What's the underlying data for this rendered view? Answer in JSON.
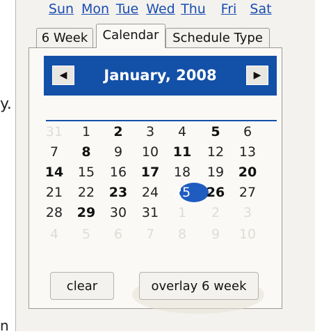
{
  "edge_text": {
    "left_char": "y.",
    "bottom_char": "n"
  },
  "tabs": [
    {
      "label": "6 Week",
      "active": false
    },
    {
      "label": "Calendar",
      "active": true
    },
    {
      "label": "Schedule Type",
      "active": false
    }
  ],
  "calendar": {
    "title": "January, 2008",
    "prev_icon": "left-triangle-icon",
    "next_icon": "right-triangle-icon",
    "header_color": "#1350a8",
    "weekdays": [
      "Sun",
      "Mon",
      "Tue",
      "Wed",
      "Thu",
      "Fri",
      "Sat"
    ],
    "weeks": [
      [
        {
          "d": "31",
          "faded": true
        },
        {
          "d": "1"
        },
        {
          "d": "2",
          "bold": true
        },
        {
          "d": "3"
        },
        {
          "d": "4"
        },
        {
          "d": "5",
          "bold": true
        },
        {
          "d": "6"
        }
      ],
      [
        {
          "d": "7"
        },
        {
          "d": "8",
          "bold": true
        },
        {
          "d": "9"
        },
        {
          "d": "10"
        },
        {
          "d": "11",
          "bold": true
        },
        {
          "d": "12"
        },
        {
          "d": "13"
        }
      ],
      [
        {
          "d": "14",
          "bold": true
        },
        {
          "d": "15"
        },
        {
          "d": "16"
        },
        {
          "d": "17",
          "bold": true
        },
        {
          "d": "18"
        },
        {
          "d": "19"
        },
        {
          "d": "20",
          "bold": true
        }
      ],
      [
        {
          "d": "21"
        },
        {
          "d": "22"
        },
        {
          "d": "23",
          "bold": true
        },
        {
          "d": "24"
        },
        {
          "d": "25",
          "today": true
        },
        {
          "d": "26",
          "bold": true
        },
        {
          "d": "27"
        }
      ],
      [
        {
          "d": "28"
        },
        {
          "d": "29",
          "bold": true
        },
        {
          "d": "30"
        },
        {
          "d": "31"
        },
        {
          "d": "1",
          "faded": true
        },
        {
          "d": "2",
          "faded": true
        },
        {
          "d": "3",
          "faded": true
        }
      ],
      [
        {
          "d": "4",
          "faded": true
        },
        {
          "d": "5",
          "faded": true
        },
        {
          "d": "6",
          "faded": true
        },
        {
          "d": "7",
          "faded": true
        },
        {
          "d": "8",
          "faded": true
        },
        {
          "d": "9",
          "faded": true
        },
        {
          "d": "10",
          "faded": true
        }
      ]
    ]
  },
  "buttons": {
    "clear": "clear",
    "overlay": "overlay 6 week"
  }
}
